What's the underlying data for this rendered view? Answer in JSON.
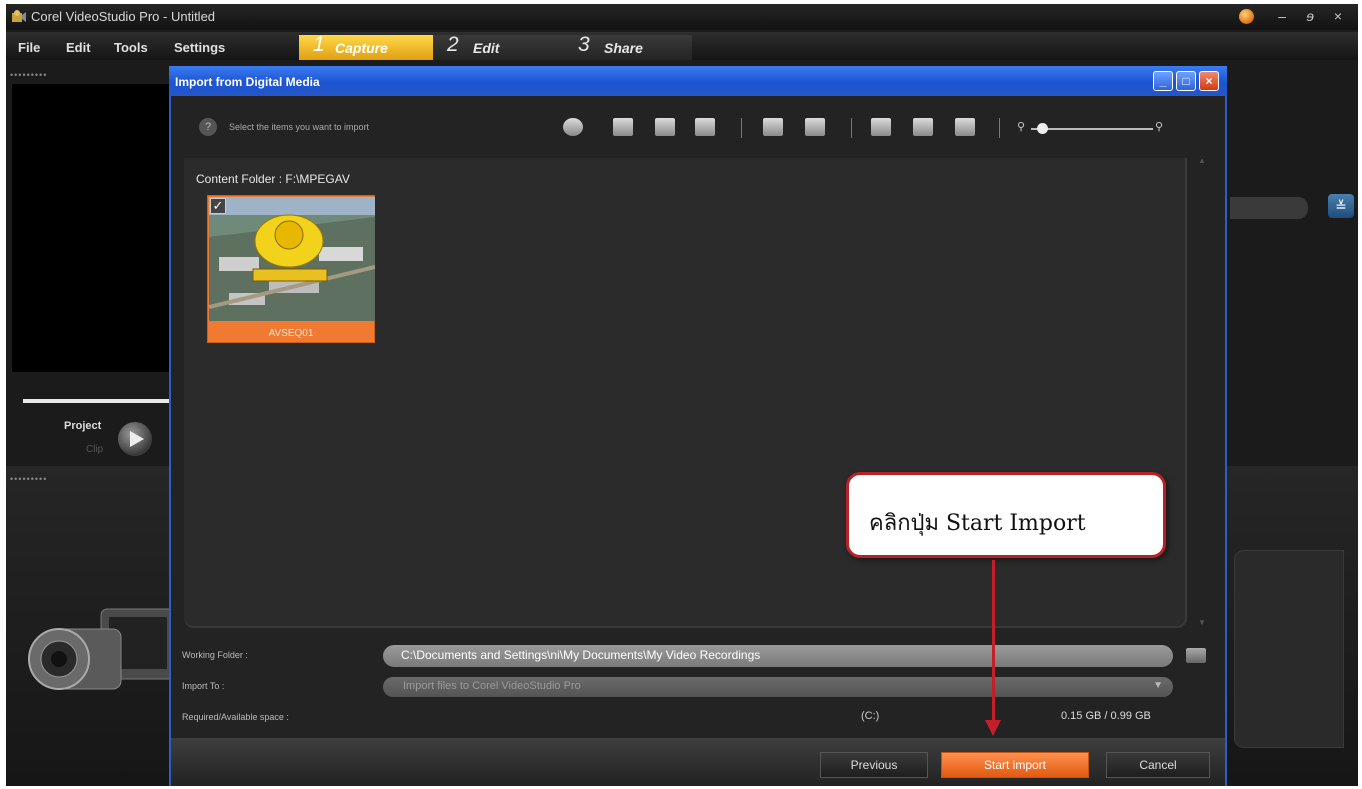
{
  "app": {
    "title": "Corel VideoStudio Pro - Untitled",
    "menus": [
      "File",
      "Edit",
      "Tools",
      "Settings"
    ],
    "steps": [
      {
        "num": "1",
        "label": "Capture"
      },
      {
        "num": "2",
        "label": "Edit"
      },
      {
        "num": "3",
        "label": "Share"
      }
    ],
    "project_label": "Project",
    "clip_label": "Clip"
  },
  "dialog": {
    "title": "Import from Digital Media",
    "instruction": "Select the items you want to import",
    "content_folder": "Content Folder : F:\\MPEGAV",
    "thumbnail": {
      "label": "AVSEQ01",
      "checked": true
    },
    "working_folder_label": "Working Folder :",
    "working_folder_value": "C:\\Documents and Settings\\ni\\My Documents\\My Video Recordings",
    "import_to_label": "Import To :",
    "import_to_value": "Import files to Corel VideoStudio Pro",
    "space_label": "Required/Available space :",
    "drive": "(C:)",
    "space_value": "0.15 GB / 0.99 GB",
    "buttons": {
      "previous": "Previous",
      "start_import": "Start import",
      "cancel": "Cancel"
    }
  },
  "annotation": {
    "text": "คลิกปุ่ม Start Import"
  },
  "colors": {
    "accent": "#e86a1c",
    "dialog_title": "#1c54d2",
    "callout_border": "#b82028",
    "capture_tab": "#f0c030"
  }
}
